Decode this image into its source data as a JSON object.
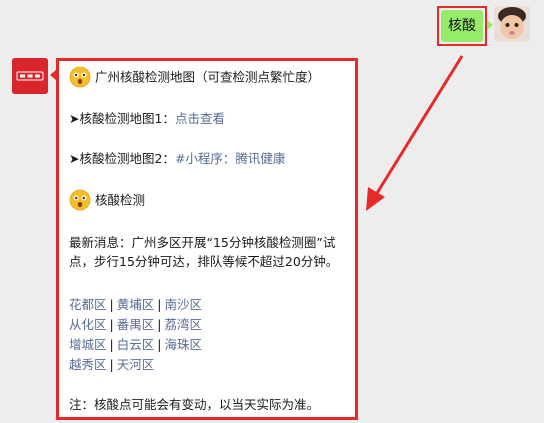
{
  "chat": {
    "outgoing": {
      "text": "核酸",
      "avatar_icon": "baby-avatar-icon"
    },
    "bot": {
      "avatar_icon": "brand-logo-icon"
    },
    "reply": {
      "title_emoji": "flushed-face-icon",
      "title": "广州核酸检测地图（可查检测点繁忙度）",
      "map1_prefix": "➤核酸检测地图1：",
      "map1_link": "点击查看",
      "map2_prefix": "➤核酸检测地图2：",
      "map2_link": "#小程序：腾讯健康",
      "section_emoji": "flushed-face-icon",
      "section_title": "核酸检测",
      "news": "最新消息：广州多区开展“15分钟核酸检测圈”试点，步行15分钟可达，排队等候不超过20分钟。",
      "districts": [
        [
          "花都区",
          "黄埔区",
          "南沙区"
        ],
        [
          "从化区",
          "番禺区",
          "荔湾区"
        ],
        [
          "增城区",
          "白云区",
          "海珠区"
        ],
        [
          "越秀区",
          "天河区"
        ]
      ],
      "separator": "|",
      "note": "注：核酸点可能会有变动，以当天实际为准。"
    }
  },
  "colors": {
    "background": "#ededed",
    "outgoing_bubble": "#95ec69",
    "link": "#576b95",
    "highlight": "#e62a2a"
  }
}
